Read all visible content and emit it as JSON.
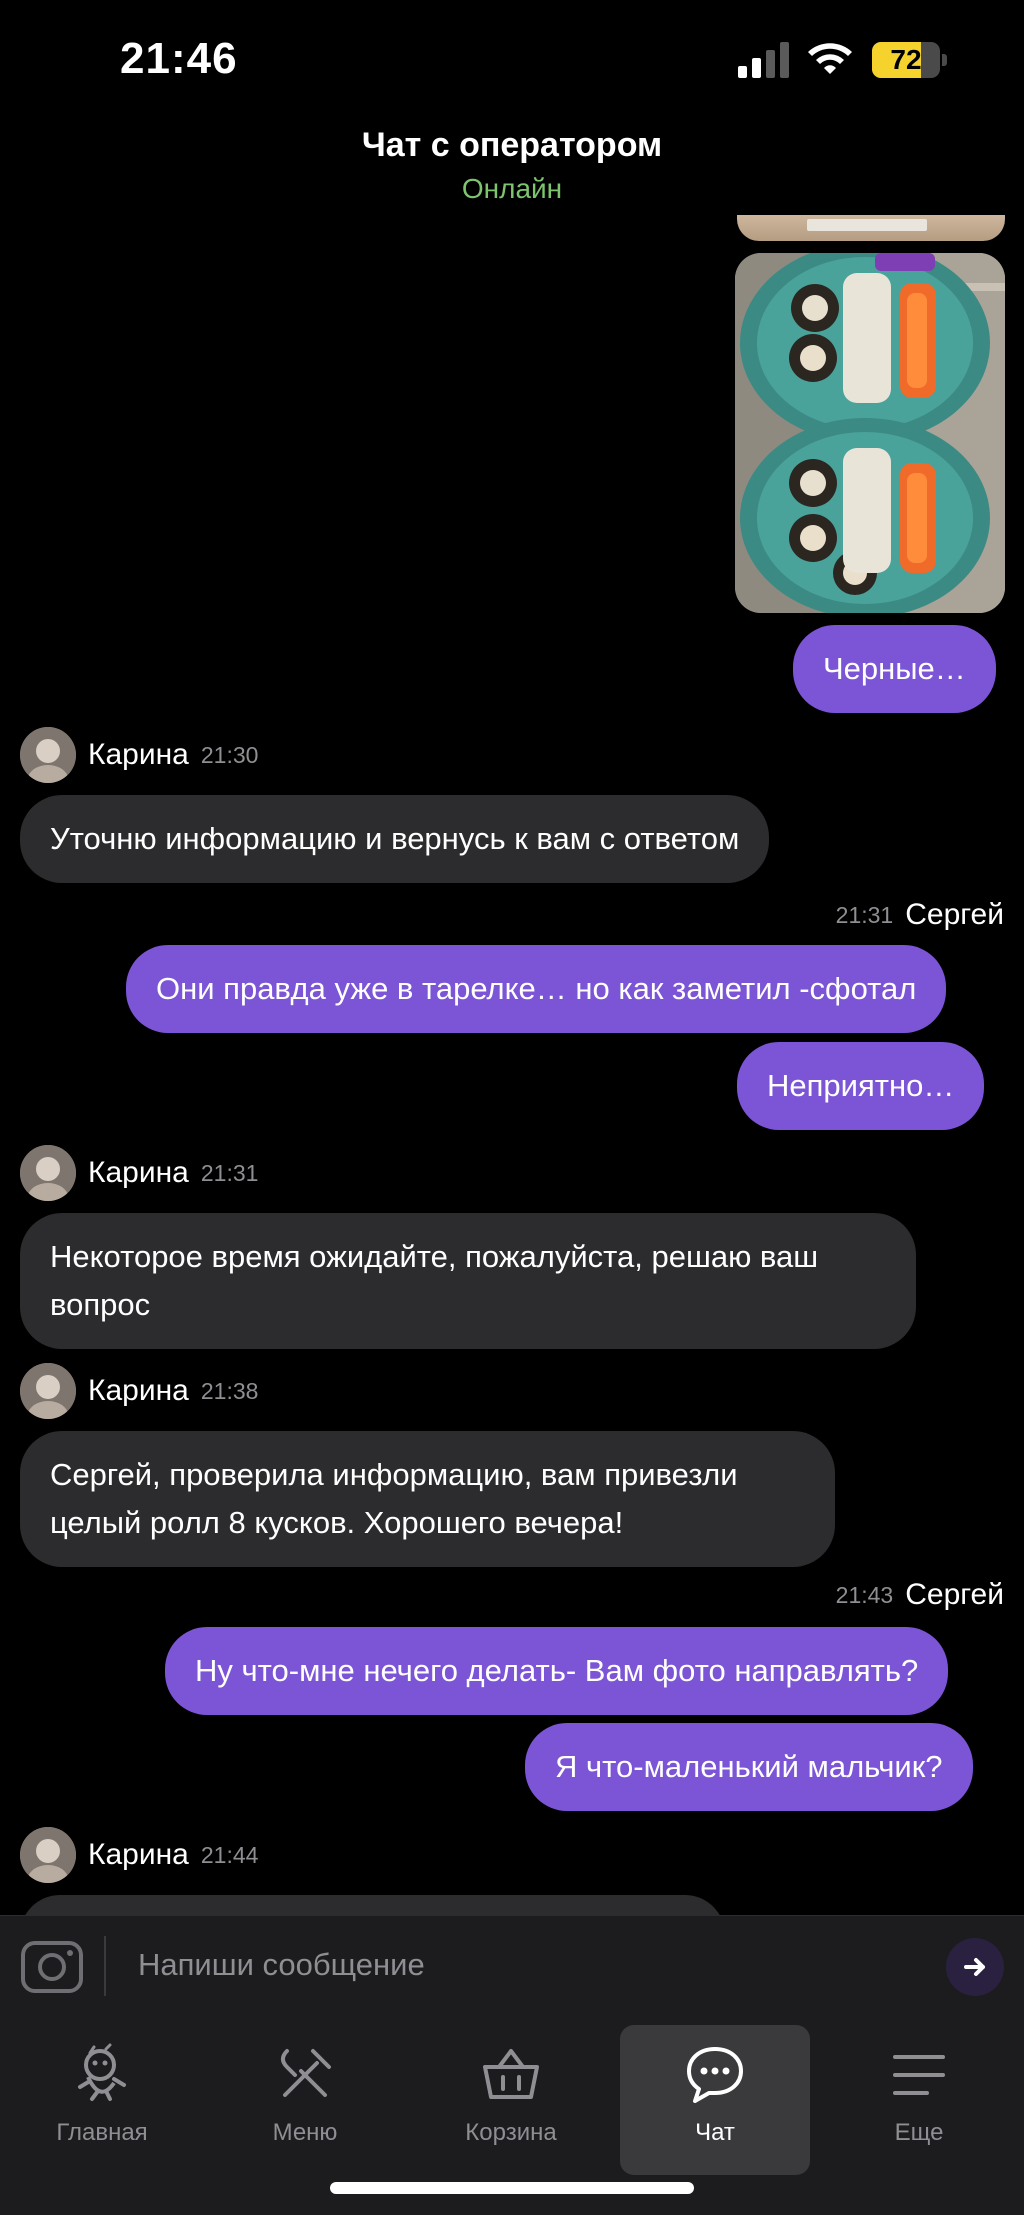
{
  "status_bar": {
    "time": "21:46",
    "battery_percent": "72",
    "battery_level": 0.72,
    "battery_color": "#f5d22c"
  },
  "header": {
    "title": "Чат с оператором",
    "status": "Онлайн",
    "status_color": "#7ec46e"
  },
  "messages": {
    "out_image_1": "sushi-photo",
    "out_1": "Черные…",
    "karina_1": {
      "name": "Карина",
      "time": "21:30",
      "text": "Уточню информацию и вернусь к вам с ответом"
    },
    "sergey_1": {
      "name": "Сергей",
      "time": "21:31"
    },
    "out_2": "Они правда уже в тарелке… но как заметил -сфотал",
    "out_3": "Неприятно…",
    "karina_2": {
      "name": "Карина",
      "time": "21:31",
      "text": "Некоторое время ожидайте, пожалуйста, решаю ваш вопрос"
    },
    "karina_3": {
      "name": "Карина",
      "time": "21:38",
      "text": "Сергей, проверила информацию, вам привезли целый ролл 8 кусков. Хорошего вечера!"
    },
    "sergey_2": {
      "name": "Сергей",
      "time": "21:43"
    },
    "out_4": "Ну что-мне нечего делать- Вам фото направлять?",
    "out_5": "Я что-маленький мальчик?",
    "karina_4": {
      "name": "Карина",
      "time": "21:44"
    }
  },
  "colors": {
    "outgoing_bubble": "#7b55d6",
    "incoming_bubble": "#2c2c2e"
  },
  "input": {
    "placeholder": "Напиши сообщение"
  },
  "tabs": [
    {
      "label": "Главная",
      "icon": "mascot-icon",
      "active": false
    },
    {
      "label": "Меню",
      "icon": "fork-knife-icon",
      "active": false
    },
    {
      "label": "Корзина",
      "icon": "basket-icon",
      "active": false
    },
    {
      "label": "Чат",
      "icon": "chat-bubble-icon",
      "active": true
    },
    {
      "label": "Еще",
      "icon": "menu-lines-icon",
      "active": false
    }
  ]
}
